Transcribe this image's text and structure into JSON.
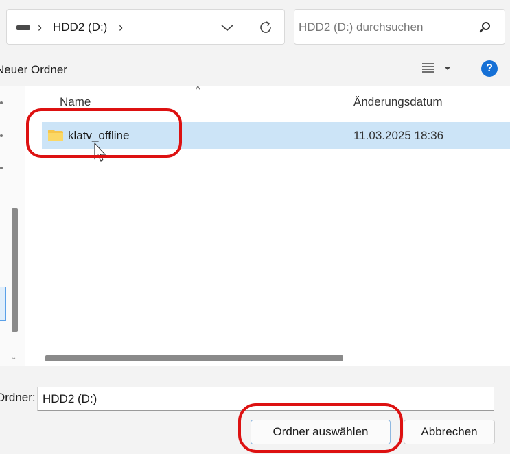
{
  "window": {
    "address": {
      "drive": "HDD2 (D:)"
    },
    "search": {
      "placeholder": "HDD2 (D:) durchsuchen"
    },
    "toolbar": {
      "new_folder": "Neuer Ordner"
    },
    "columns": {
      "name": "Name",
      "modified": "Änderungsdatum"
    },
    "files": [
      {
        "name": "klatv_offline",
        "modified": "11.03.2025 18:36",
        "icon": "folder-icon",
        "selected": true
      }
    ],
    "footer": {
      "folder_label": "Ordner:",
      "folder_value": "HDD2 (D:)",
      "select_button": "Ordner auswählen",
      "cancel_button": "Abbrechen"
    }
  },
  "icons": [
    "drive-icon",
    "chevron-down-icon",
    "refresh-icon",
    "search-icon",
    "view-options-icon",
    "help-icon",
    "folder-icon",
    "cursor-icon"
  ],
  "colors": {
    "selection": "#cce4f7",
    "accent": "#1570d6",
    "highlight": "#dd1111",
    "folder": "#f6c64b"
  }
}
